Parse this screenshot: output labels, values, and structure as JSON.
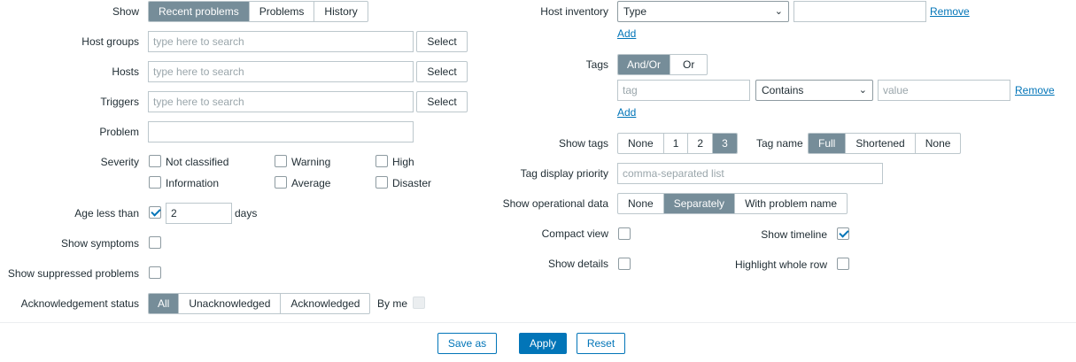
{
  "left": {
    "show": {
      "label": "Show",
      "options": [
        "Recent problems",
        "Problems",
        "History"
      ],
      "selected": "Recent problems"
    },
    "host_groups": {
      "label": "Host groups",
      "placeholder": "type here to search",
      "button": "Select"
    },
    "hosts": {
      "label": "Hosts",
      "placeholder": "type here to search",
      "button": "Select"
    },
    "triggers": {
      "label": "Triggers",
      "placeholder": "type here to search",
      "button": "Select"
    },
    "problem": {
      "label": "Problem",
      "value": ""
    },
    "severity": {
      "label": "Severity",
      "items": [
        "Not classified",
        "Warning",
        "High",
        "Information",
        "Average",
        "Disaster"
      ]
    },
    "age": {
      "label": "Age less than",
      "checked": true,
      "value": "2",
      "unit": "days"
    },
    "show_symptoms": {
      "label": "Show symptoms",
      "checked": false
    },
    "show_suppressed": {
      "label": "Show suppressed problems",
      "checked": false
    },
    "ack_status": {
      "label": "Acknowledgement status",
      "options": [
        "All",
        "Unacknowledged",
        "Acknowledged"
      ],
      "selected": "All",
      "by_me": "By me"
    }
  },
  "right": {
    "host_inventory": {
      "label": "Host inventory",
      "select_value": "Type",
      "value": "",
      "remove": "Remove",
      "add": "Add"
    },
    "tags": {
      "label": "Tags",
      "operator_options": [
        "And/Or",
        "Or"
      ],
      "operator_selected": "And/Or",
      "tag_placeholder": "tag",
      "condition": "Contains",
      "value_placeholder": "value",
      "remove": "Remove",
      "add": "Add"
    },
    "show_tags": {
      "label": "Show tags",
      "options": [
        "None",
        "1",
        "2",
        "3"
      ],
      "selected": "3"
    },
    "tag_name": {
      "label": "Tag name",
      "options": [
        "Full",
        "Shortened",
        "None"
      ],
      "selected": "Full"
    },
    "tag_priority": {
      "label": "Tag display priority",
      "placeholder": "comma-separated list"
    },
    "operational_data": {
      "label": "Show operational data",
      "options": [
        "None",
        "Separately",
        "With problem name"
      ],
      "selected": "Separately"
    },
    "compact_view": {
      "label": "Compact view",
      "checked": false
    },
    "show_timeline": {
      "label": "Show timeline",
      "checked": true
    },
    "show_details": {
      "label": "Show details",
      "checked": false
    },
    "highlight_row": {
      "label": "Highlight whole row",
      "checked": false
    }
  },
  "footer": {
    "save_as": "Save as",
    "apply": "Apply",
    "reset": "Reset"
  },
  "colors": {
    "accent": "#0275b8",
    "segment_on": "#768d99",
    "border": "#bcc7cc"
  }
}
